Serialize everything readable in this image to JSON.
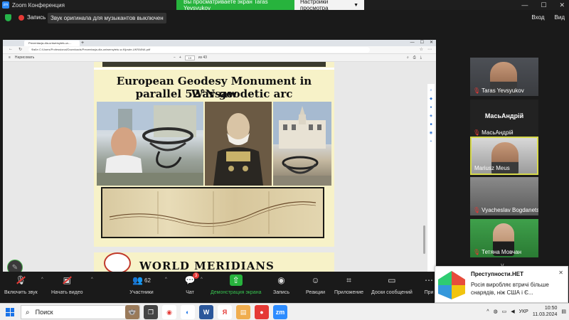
{
  "zoom_window": {
    "title": "Zoom Конференция",
    "share_banner": "Вы просматриваете экран Taras Yevsyukov",
    "view_settings": "Настройки просмотра"
  },
  "topbar": {
    "record_label": "Запись",
    "audio_banner": "Звук оригинала для музыкантов выключен",
    "login": "Вход",
    "view": "Вид"
  },
  "browser": {
    "tab_title": "Prezentacja-dla-uniwersytetu-w-...",
    "url_prefix": "Файл",
    "url": "C:/Users/Professional/Downloads/Prezentacja-dla-uniwersytetu-w-Kijowie-UKRAINA.pdf",
    "pdf_toolbar_left": "Нарисовать",
    "page_current": "19",
    "page_total": "из 43"
  },
  "slide": {
    "title_line1": "European Geodesy Monument in Warsaw",
    "title_line2": "parallel 52°N geodetic arc",
    "next_title": "WORLD MERIDIANS"
  },
  "participants": [
    {
      "name": "Taras Yevsyukov",
      "muted": true
    },
    {
      "name": "МасьАндрій",
      "muted": true,
      "big_name": "МасьАндрій"
    },
    {
      "name": "Mariusz Meus",
      "muted": false,
      "active": true
    },
    {
      "name": "Vyacheslav Bogdanets",
      "muted": true
    },
    {
      "name": "Тетяна Мовчан",
      "muted": true
    }
  ],
  "toolbar": {
    "audio": "Включить звук",
    "video": "Начать видео",
    "participants": "Участники",
    "participants_count": "62",
    "chat": "Чат",
    "chat_badge": "3",
    "share": "Демонстрация экрана",
    "record": "Запись",
    "reactions": "Реакции",
    "apps": "Приложение",
    "whiteboard": "Доски сообщений",
    "more": "При"
  },
  "notification": {
    "title": "Преступности.НЕТ",
    "body": "Росія виробляє втричі більше снарядів, ніж США і Є..."
  },
  "taskbar": {
    "search": "Поиск",
    "lang": "УКР",
    "time": "10:50",
    "date": "11.03.2024"
  },
  "colors": {
    "zoom_green": "#27b33d",
    "slide_bg": "#f7f2c8",
    "active_border": "#d7d94b",
    "mute_red": "#e53935"
  }
}
